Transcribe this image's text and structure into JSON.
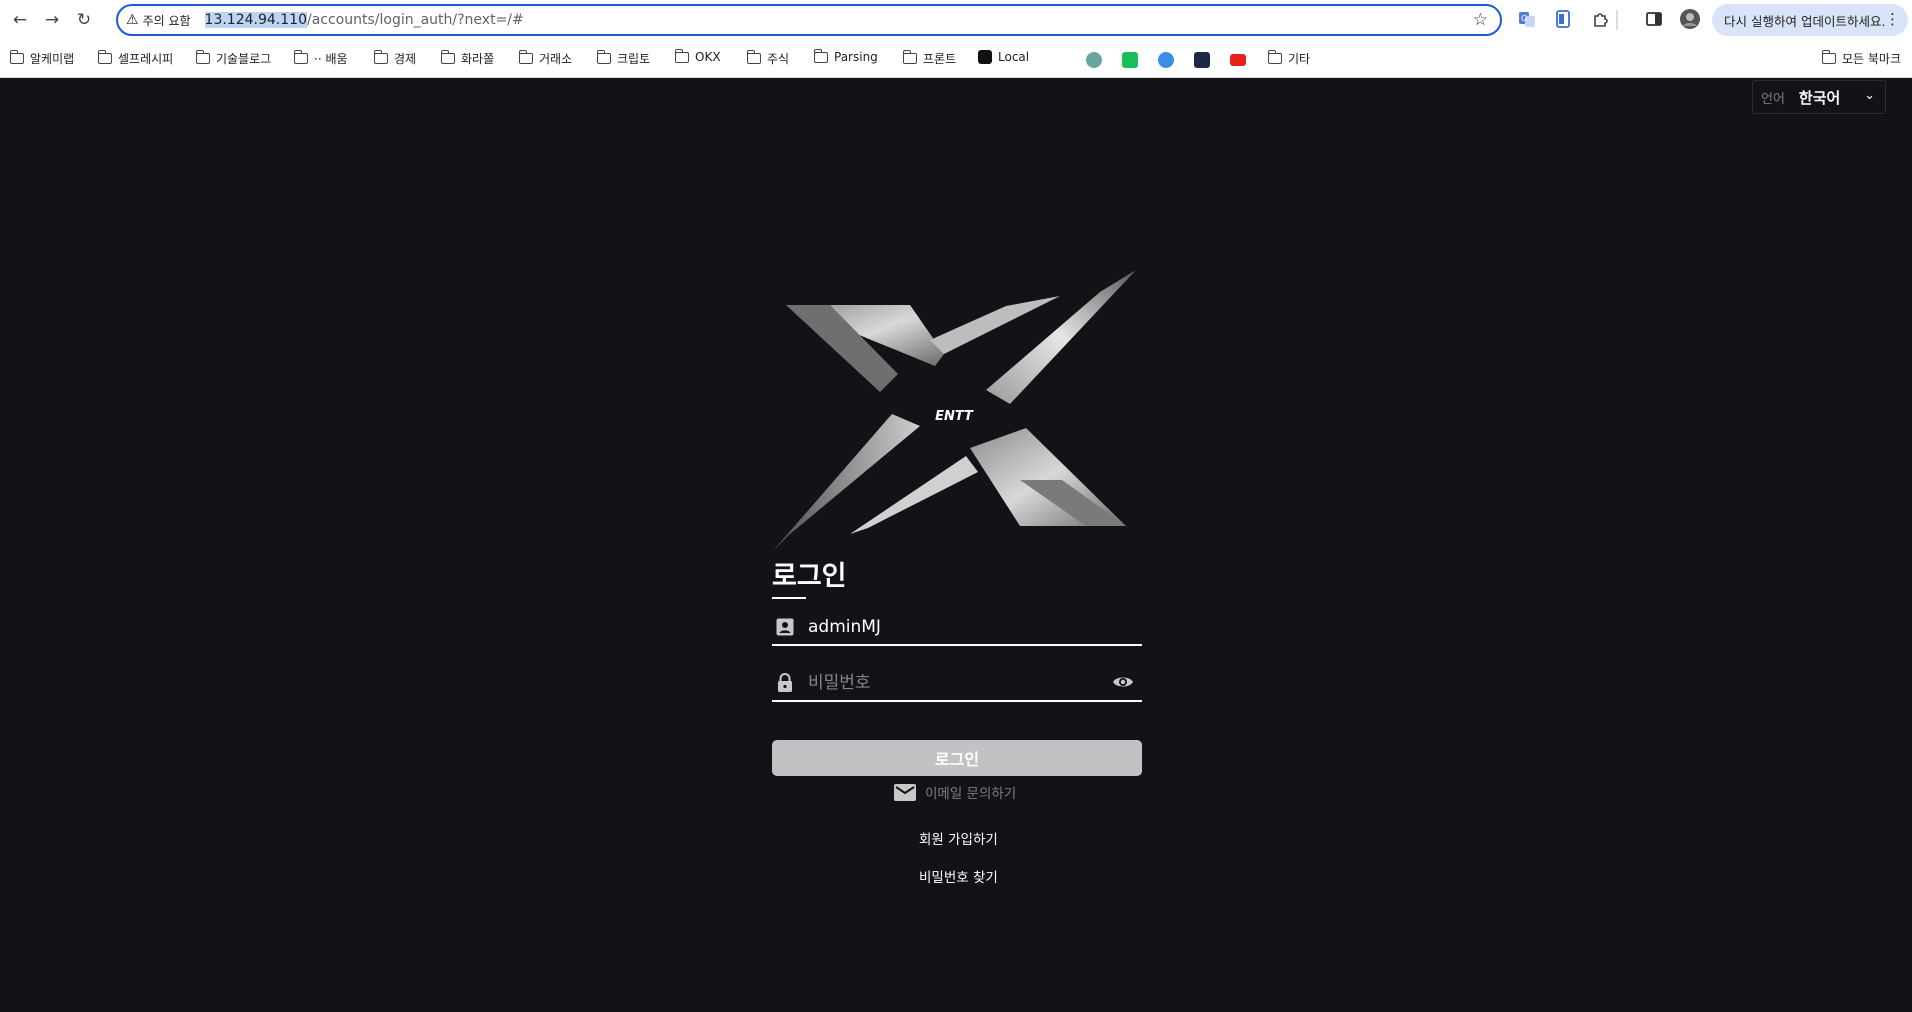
{
  "browser": {
    "security_label": "주의 요함",
    "url_host": "13.124.94.110",
    "url_path": "/accounts/login_auth/?next=/#",
    "update_label": "다시 실행하여 업데이트하세요.",
    "bookmarks": [
      {
        "label": "알케미랩",
        "type": "folder"
      },
      {
        "label": "셀프레시피",
        "type": "folder"
      },
      {
        "label": "기술블로그",
        "type": "folder"
      },
      {
        "label": "⋅⋅ 배움",
        "type": "folder"
      },
      {
        "label": "경제",
        "type": "folder"
      },
      {
        "label": "화라쫄",
        "type": "folder"
      },
      {
        "label": "거래소",
        "type": "folder"
      },
      {
        "label": "크립토",
        "type": "folder"
      },
      {
        "label": "OKX",
        "type": "folder"
      },
      {
        "label": "주식",
        "type": "folder"
      },
      {
        "label": "Parsing",
        "type": "folder"
      },
      {
        "label": "프론트",
        "type": "folder"
      },
      {
        "label": "Local",
        "type": "site"
      },
      {
        "label": "기타",
        "type": "folder"
      }
    ],
    "all_bookmarks_label": "모든 북마크"
  },
  "language": {
    "label": "언어",
    "value": "한국어"
  },
  "logo": {
    "text": "ENTT"
  },
  "login": {
    "title": "로그인",
    "username_value": "adminMJ",
    "password_placeholder": "비밀번호",
    "submit_label": "로그인",
    "email_inquiry_label": "이메일 문의하기",
    "signup_label": "회원 가입하기",
    "find_password_label": "비밀번호 찾기"
  },
  "colors": {
    "page_bg": "#141217",
    "button_bg": "#c2c2c4",
    "omnibox_border": "#1a5bd6"
  }
}
